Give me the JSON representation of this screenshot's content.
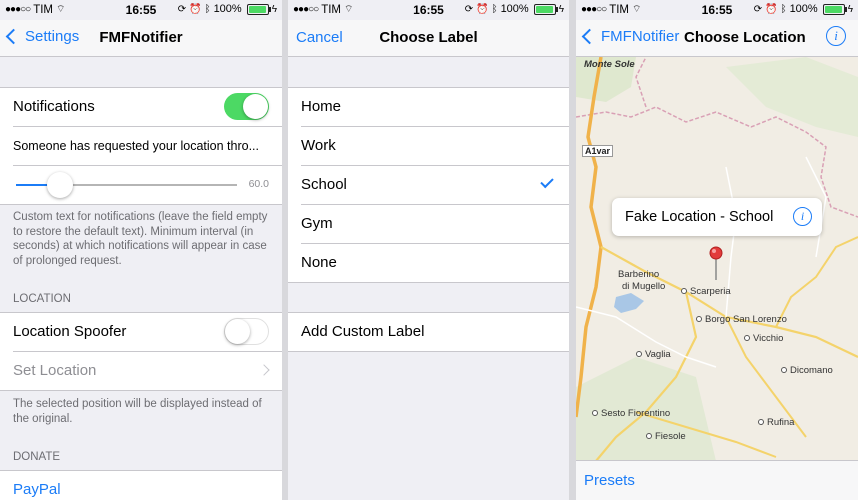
{
  "status_bar": {
    "carrier": "TIM",
    "time": "16:55",
    "battery_percent": "100%",
    "battery_level": 1.0,
    "icons": [
      "signal-dots-icon",
      "wifi-icon",
      "rotation-lock-icon",
      "alarm-icon",
      "bluetooth-icon",
      "battery-icon",
      "charging-icon"
    ]
  },
  "screen1": {
    "nav": {
      "back_label": "Settings",
      "title": "FMFNotifier"
    },
    "notifications_label": "Notifications",
    "notifications_on": true,
    "custom_text": "Someone has requested your location thro...",
    "slider_value": "60.0",
    "slider_fraction": 0.2,
    "footer_notifications": "Custom text for notifications (leave the field empty to restore the default text). Minimum interval (in seconds) at which notifications will appear in case of prolonged request.",
    "location_header": "LOCATION",
    "location_spoofer_label": "Location Spoofer",
    "location_spoofer_on": false,
    "set_location_label": "Set Location",
    "footer_location": "The selected position will be displayed instead of the original.",
    "donate_header": "DONATE",
    "paypal_label": "PayPal"
  },
  "screen2": {
    "nav": {
      "cancel_label": "Cancel",
      "title": "Choose Label"
    },
    "labels": [
      "Home",
      "Work",
      "School",
      "Gym",
      "None"
    ],
    "selected": "School",
    "add_custom_label": "Add Custom Label"
  },
  "screen3": {
    "nav": {
      "back_label": "FMFNotifier",
      "title": "Choose Location"
    },
    "callout_text": "Fake Location - School",
    "places": {
      "monte_sole": "Monte Sole",
      "a1var": "A1var",
      "barberino": "Barberino",
      "di_mugello": "di Mugello",
      "scarperia": "Scarperia",
      "borgo": "Borgo San Lorenzo",
      "vicchio": "Vicchio",
      "vaglia": "Vaglia",
      "dicomano": "Dicomano",
      "sesto": "Sesto Fiorentino",
      "fiesole": "Fiesole",
      "rufina": "Rufina"
    },
    "toolbar_presets": "Presets"
  },
  "colors": {
    "accent": "#1b7cf7",
    "switch_on": "#4cd964",
    "group_bg": "#efeff4"
  }
}
